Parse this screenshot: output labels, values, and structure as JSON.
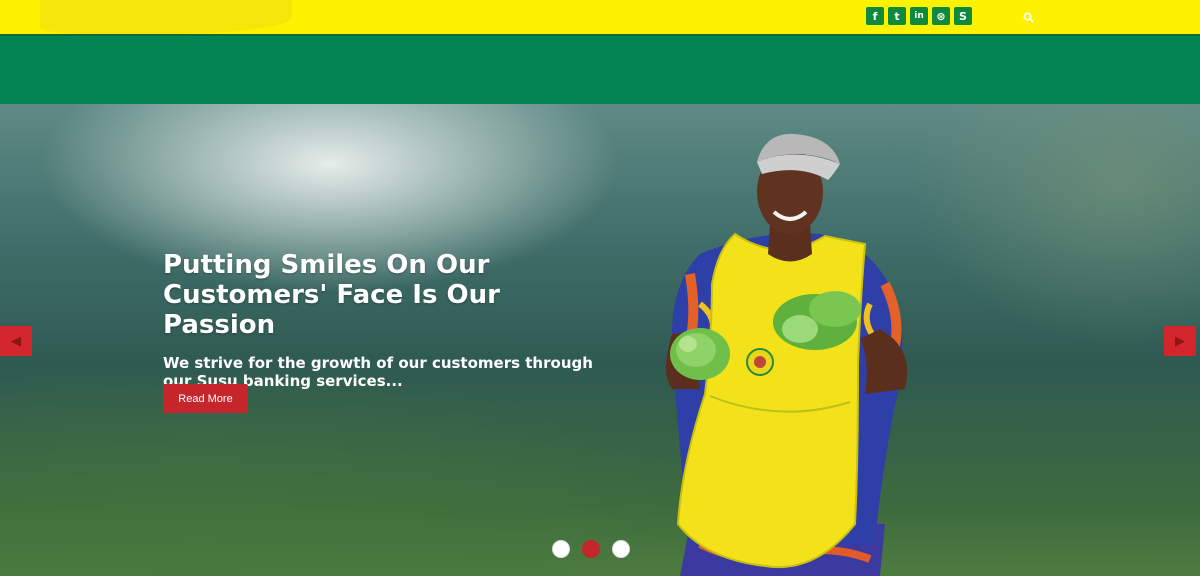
{
  "header": {
    "social_icons": [
      {
        "name": "facebook-icon",
        "glyph": "f"
      },
      {
        "name": "twitter-icon",
        "glyph": "t"
      },
      {
        "name": "linkedin-icon",
        "glyph": "in"
      },
      {
        "name": "dribbble-icon",
        "glyph": "⊛"
      },
      {
        "name": "skype-icon",
        "glyph": "S"
      }
    ],
    "search_icon": "search-icon",
    "colors": {
      "topbar": "#fdf200",
      "navbar": "#058453",
      "icon_bg": "#0f8a3c"
    }
  },
  "slider": {
    "title": "Putting Smiles On Our Customers' Face Is Our Passion",
    "text": "We strive for the growth of our customers through our Susu banking services...",
    "button_label": "Read More",
    "active_slide": 2,
    "slide_count": 3,
    "colors": {
      "accent": "#c4262b"
    }
  }
}
